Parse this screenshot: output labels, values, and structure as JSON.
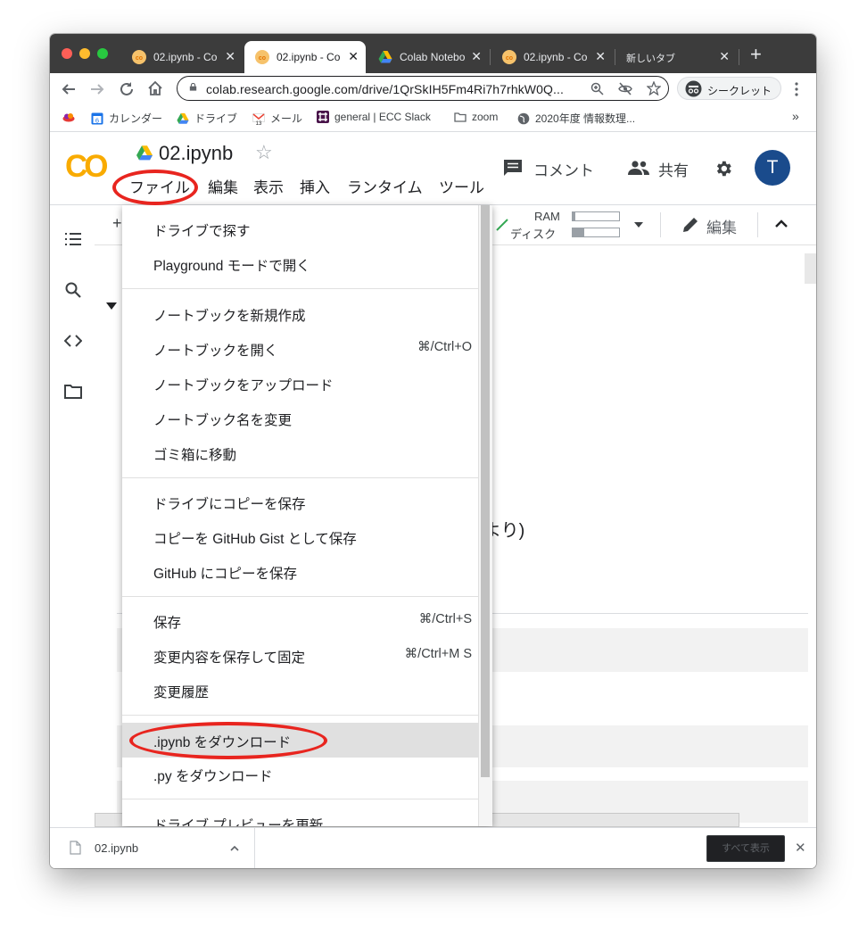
{
  "browser": {
    "tabs": [
      {
        "title": "02.ipynb - Co",
        "icon": "colab-icon",
        "active": false
      },
      {
        "title": "02.ipynb - Co",
        "icon": "colab-icon",
        "active": true
      },
      {
        "title": "Colab Notebo",
        "icon": "drive-icon",
        "active": false
      },
      {
        "title": "02.ipynb - Co",
        "icon": "colab-icon",
        "active": false
      },
      {
        "title": "新しいタブ",
        "icon": "none",
        "active": false
      }
    ],
    "close_glyph": "✕",
    "new_tab_glyph": "+",
    "url": "colab.research.google.com/drive/1QrSkIH5Fm4Ri7h7rhkW0Q...",
    "incognito_label": "シークレット"
  },
  "bookmarks": [
    {
      "label": "",
      "icon": "cloud-icon"
    },
    {
      "label": "カレンダー",
      "icon": "calendar-icon",
      "badge": "6"
    },
    {
      "label": "ドライブ",
      "icon": "drive-icon"
    },
    {
      "label": "メール",
      "icon": "gmail-icon",
      "badge": "13"
    },
    {
      "label": "general | ECC Slack",
      "icon": "slack-icon"
    },
    {
      "label": "zoom",
      "icon": "folder-icon"
    },
    {
      "label": "2020年度 情報数理...",
      "icon": "globe-icon"
    }
  ],
  "bookmarks_more": "»",
  "colab": {
    "logo_text": "CO",
    "notebook_title": "02.ipynb",
    "menu": [
      "ファイル",
      "編集",
      "表示",
      "挿入",
      "ランタイム",
      "ツール"
    ],
    "comment_label": "コメント",
    "share_label": "共有",
    "avatar_letter": "T",
    "toolbar": {
      "add_glyph": "+",
      "ram_label": "RAM",
      "disk_label": "ディスク",
      "edit_label": "編集"
    },
    "cell_fragment": "より)"
  },
  "file_menu": {
    "groups": [
      [
        {
          "label": "ドライブで探す",
          "shortcut": ""
        },
        {
          "label": "Playground モードで開く",
          "shortcut": ""
        }
      ],
      [
        {
          "label": "ノートブックを新規作成",
          "shortcut": ""
        },
        {
          "label": "ノートブックを開く",
          "shortcut": "⌘/Ctrl+O"
        },
        {
          "label": "ノートブックをアップロード",
          "shortcut": ""
        },
        {
          "label": "ノートブック名を変更",
          "shortcut": ""
        },
        {
          "label": "ゴミ箱に移動",
          "shortcut": ""
        }
      ],
      [
        {
          "label": "ドライブにコピーを保存",
          "shortcut": ""
        },
        {
          "label": "コピーを GitHub Gist として保存",
          "shortcut": ""
        },
        {
          "label": "GitHub にコピーを保存",
          "shortcut": ""
        }
      ],
      [
        {
          "label": "保存",
          "shortcut": "⌘/Ctrl+S"
        },
        {
          "label": "変更内容を保存して固定",
          "shortcut": "⌘/Ctrl+M S"
        },
        {
          "label": "変更履歴",
          "shortcut": ""
        }
      ],
      [
        {
          "label": ".ipynb をダウンロード",
          "shortcut": "",
          "highlighted": true
        },
        {
          "label": ".py をダウンロード",
          "shortcut": ""
        }
      ],
      [
        {
          "label": "ドライブ プレビューを更新",
          "shortcut": ""
        }
      ]
    ]
  },
  "download_bar": {
    "filename": "02.ipynb",
    "show_all_label": "すべて表示",
    "close_glyph": "✕"
  },
  "colors": {
    "annotation_ring": "#e8251f",
    "colab_orange": "#f9ab00",
    "avatar_bg": "#1a4b8c",
    "tab_strip": "#3c3c3c"
  }
}
